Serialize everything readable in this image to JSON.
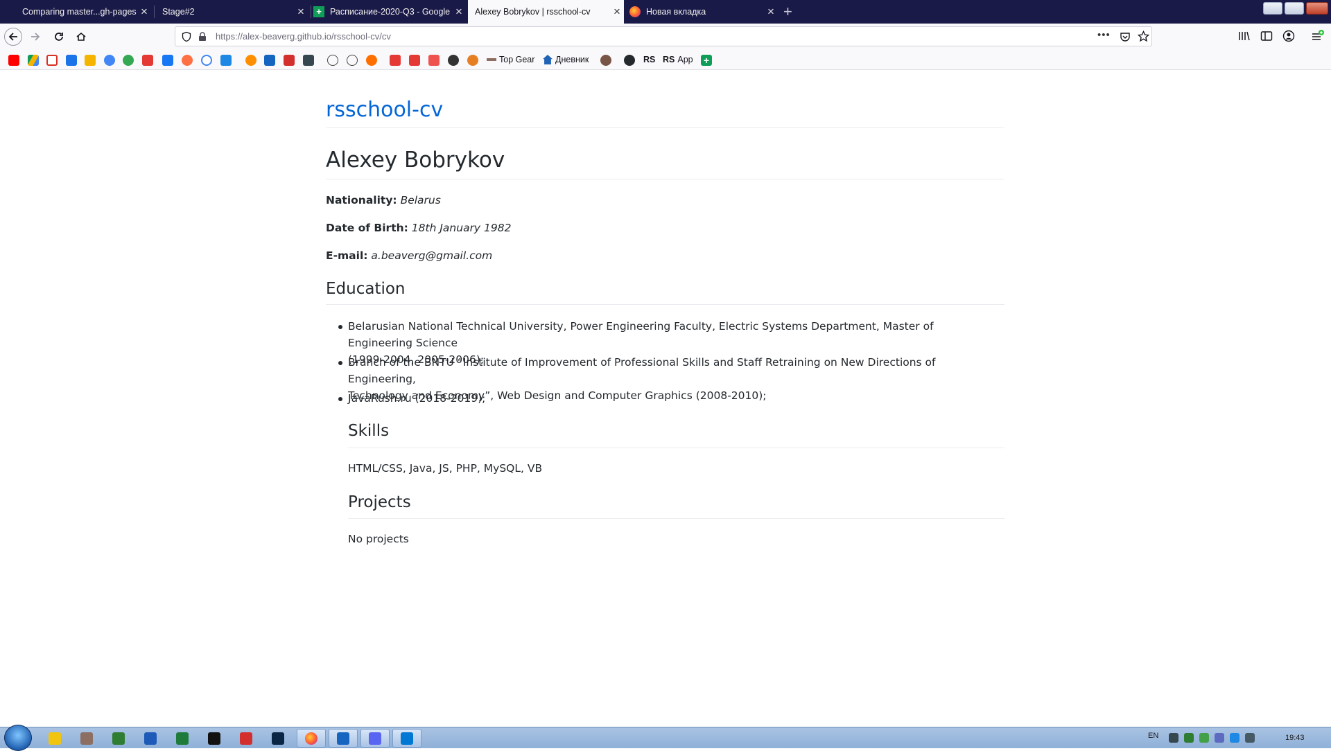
{
  "browser": {
    "tabs": [
      {
        "title": "Comparing master...gh-pages",
        "active": false
      },
      {
        "title": "Stage#2",
        "active": false
      },
      {
        "title": "Расписание-2020-Q3 - Google",
        "active": false
      },
      {
        "title": "Alexey Bobrykov | rsschool-cv",
        "active": true
      },
      {
        "title": "Новая вкладка",
        "active": false
      }
    ],
    "url_host": "https://alex-beaverg.github.io",
    "url_path": "/rsschool-cv/cv",
    "bookmarks": {
      "top_gear": "Top Gear",
      "dnevnik": "Дневник",
      "rs": "RS",
      "rs_app": "App"
    }
  },
  "page": {
    "site_title": "rsschool-cv",
    "name": "Alexey Bobrykov",
    "nationality_label": "Nationality:",
    "nationality": "Belarus",
    "dob_label": "Date of Birth:",
    "dob": "18th January 1982",
    "email_label": "E-mail:",
    "email": "a.beaverg@gmail.com",
    "education_heading": "Education",
    "education": [
      {
        "line1": "Belarusian National Technical University, Power Engineering Faculty, Electric Systems Department, Master of Engineering Science",
        "line2": "(1999-2004, 2005-2006);"
      },
      {
        "line1": "Branch of the BNTU “Institute of Improvement of Professional Skills and Staff Retraining on New Directions of Engineering,",
        "line2": "Technology and Economy”, Web Design and Computer Graphics (2008-2010);"
      },
      {
        "line1": "JavaRush.ru (2018-2019);",
        "line2": ""
      }
    ],
    "skills_heading": "Skills",
    "skills": "HTML/CSS, Java, JS, PHP, MySQL, VB",
    "projects_heading": "Projects",
    "projects": "No projects"
  },
  "taskbar": {
    "lang": "EN",
    "time": "19:43"
  },
  "colors": {
    "tabstrip": "#1a1a48",
    "link": "#0366d6",
    "text": "#24292e"
  }
}
